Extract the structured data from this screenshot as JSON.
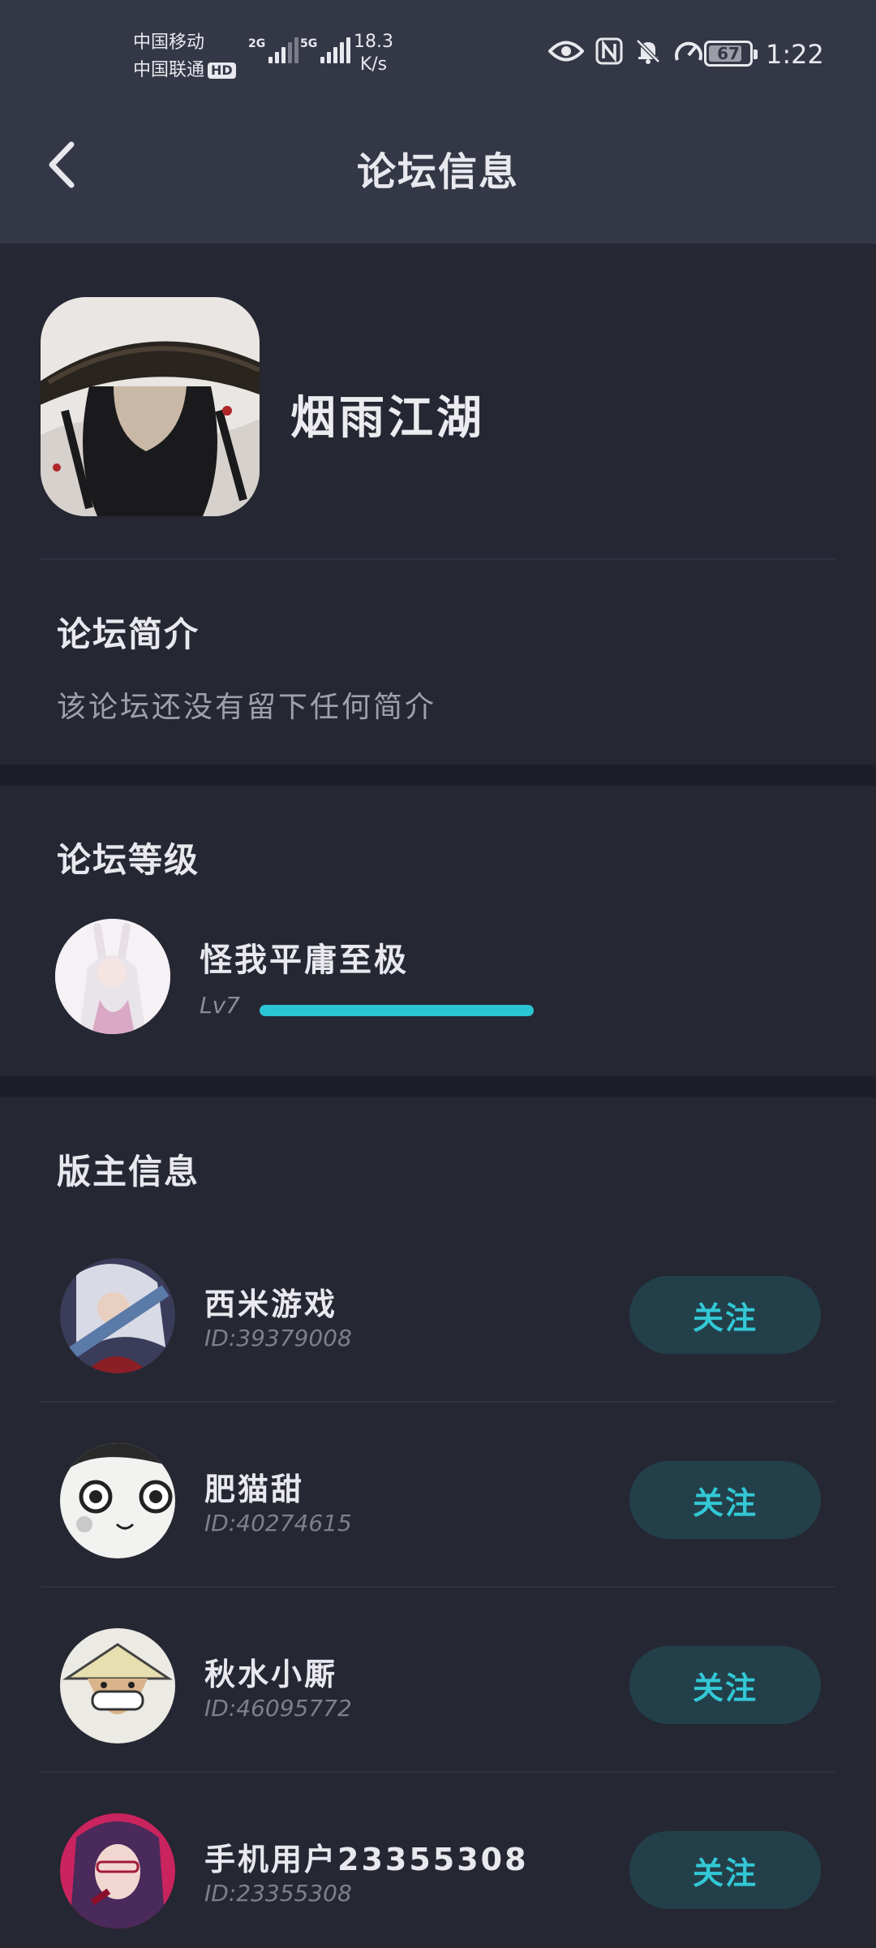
{
  "status_bar": {
    "carrier_1": "中国移动",
    "carrier_2": "中国联通",
    "hd_badge": "HD",
    "sig1_tag": "2G",
    "sig2_tag": "5G",
    "speed_value": "18.3",
    "speed_unit": "K/s",
    "battery": "67",
    "time": "1:22"
  },
  "header": {
    "title": "论坛信息"
  },
  "forum": {
    "name": "烟雨江湖"
  },
  "intro": {
    "title": "论坛简介",
    "text": "该论坛还没有留下任何简介"
  },
  "level": {
    "title": "论坛等级",
    "user": "怪我平庸至极",
    "tag": "Lv7",
    "progress_fraction": 1.0
  },
  "moderators": {
    "title": "版主信息",
    "items": [
      {
        "name": "西米游戏",
        "id": "ID:39379008",
        "follow": "关注"
      },
      {
        "name": "肥猫甜",
        "id": "ID:40274615",
        "follow": "关注"
      },
      {
        "name": "秋水小厮",
        "id": "ID:46095772",
        "follow": "关注"
      },
      {
        "name": "手机用户23355308",
        "id": "ID:23355308",
        "follow": "关注"
      }
    ]
  },
  "colors": {
    "accent": "#2bc4d4",
    "bg": "#252733",
    "header_bg": "#343846",
    "follow_bg": "#23404a"
  }
}
